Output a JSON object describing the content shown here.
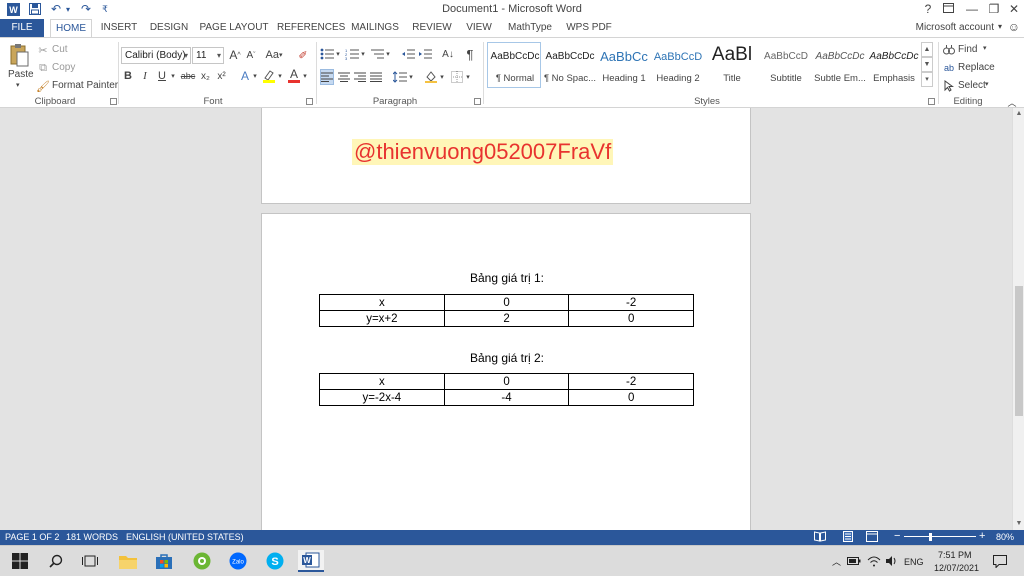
{
  "window": {
    "title": "Document1 - Microsoft Word",
    "help": "?",
    "minimize": "—",
    "restore": "❐",
    "close": "✕"
  },
  "quick_access": {
    "app_letter": "W",
    "save_icon": "floppy-icon",
    "undo": "↶",
    "redo": "↷",
    "more": "₹"
  },
  "tabs": {
    "file": "FILE",
    "items": [
      "HOME",
      "INSERT",
      "DESIGN",
      "PAGE LAYOUT",
      "REFERENCES",
      "MAILINGS",
      "REVIEW",
      "VIEW",
      "MathType",
      "WPS PDF"
    ],
    "active": "HOME"
  },
  "account": "Microsoft account",
  "ribbon": {
    "clipboard": {
      "label": "Clipboard",
      "paste": "Paste",
      "cut": "Cut",
      "copy": "Copy",
      "format_painter": "Format Painter"
    },
    "font": {
      "label": "Font",
      "font_name": "Calibri (Body)",
      "font_size": "11",
      "grow": "A",
      "shrink": "A",
      "case": "Aa",
      "bold": "B",
      "italic": "I",
      "underline": "U",
      "strike": "abc",
      "subscript": "x₂",
      "superscript": "x²",
      "text_effects": "A",
      "font_color": "A",
      "font_color_hex": "#e8332f",
      "highlight_hex": "#ffff00"
    },
    "paragraph": {
      "label": "Paragraph",
      "pilcrow": "¶"
    },
    "styles": {
      "label": "Styles",
      "items": [
        {
          "preview": "AaBbCcDc",
          "name": "¶ Normal"
        },
        {
          "preview": "AaBbCcDc",
          "name": "¶ No Spac..."
        },
        {
          "preview": "AaBbCc",
          "name": "Heading 1"
        },
        {
          "preview": "AaBbCcD",
          "name": "Heading 2"
        },
        {
          "preview": "AaBl",
          "name": "Title"
        },
        {
          "preview": "AaBbCcD",
          "name": "Subtitle"
        },
        {
          "preview": "AaBbCcDc",
          "name": "Subtle Em..."
        },
        {
          "preview": "AaBbCcDc",
          "name": "Emphasis"
        }
      ]
    },
    "editing": {
      "label": "Editing",
      "find": "Find",
      "replace": "Replace",
      "select": "Select"
    }
  },
  "document": {
    "watermark": "@thienvuong052007FraVf",
    "table1": {
      "caption": "Bảng giá trị 1:",
      "rows": [
        [
          "x",
          "0",
          "-2"
        ],
        [
          "y=x+2",
          "2",
          "0"
        ]
      ]
    },
    "table2": {
      "caption": "Bảng giá trị 2:",
      "rows": [
        [
          "x",
          "0",
          "-2"
        ],
        [
          "y=-2x-4",
          "-4",
          "0"
        ]
      ]
    }
  },
  "status": {
    "page": "PAGE 1 OF 2",
    "words": "181 WORDS",
    "language": "ENGLISH (UNITED STATES)",
    "zoom": "80%",
    "zoom_minus": "−",
    "zoom_plus": "+"
  },
  "taskbar": {
    "lang": "ENG",
    "time": "7:51 PM",
    "date": "12/07/2021"
  },
  "colors": {
    "word_blue": "#2b579a",
    "watermark_red": "#e8332f"
  }
}
